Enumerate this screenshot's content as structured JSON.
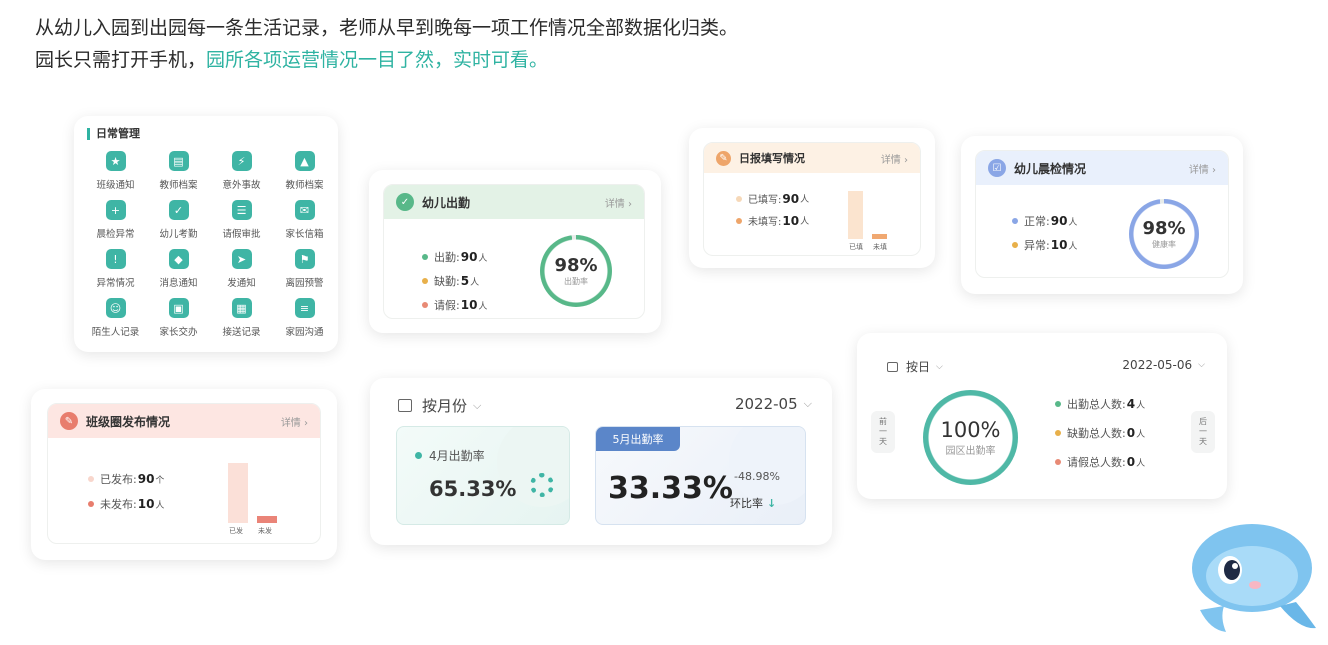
{
  "intro": {
    "line1": "从幼儿入园到出园每一条生活记录，老师从早到晚每一项工作情况全部数据化归类。",
    "line2_plain": "园长只需打开手机，",
    "line2_accent": "园所各项运营情况一目了然，实时可看。"
  },
  "daily_mgmt": {
    "title": "日常管理",
    "items": [
      {
        "label": "班级通知",
        "icon": "notice-icon",
        "color": "#3fb5a5",
        "glyph": "★"
      },
      {
        "label": "教师档案",
        "icon": "archive-icon",
        "color": "#3fb5a5",
        "glyph": "▤"
      },
      {
        "label": "意外事故",
        "icon": "accident-icon",
        "color": "#3fb5a5",
        "glyph": "⚡"
      },
      {
        "label": "教师档案",
        "icon": "bell-icon",
        "color": "#3fb5a5",
        "glyph": "▲"
      },
      {
        "label": "晨检异常",
        "icon": "medkit-icon",
        "color": "#3fb5a5",
        "glyph": "+"
      },
      {
        "label": "幼儿考勤",
        "icon": "attendance-icon",
        "color": "#3fb5a5",
        "glyph": "✓"
      },
      {
        "label": "请假审批",
        "icon": "approval-icon",
        "color": "#3fb5a5",
        "glyph": "☰"
      },
      {
        "label": "家长信箱",
        "icon": "mail-icon",
        "color": "#3fb5a5",
        "glyph": "✉"
      },
      {
        "label": "异常情况",
        "icon": "alert-icon",
        "color": "#3fb5a5",
        "glyph": "!"
      },
      {
        "label": "消息通知",
        "icon": "alarm-icon",
        "color": "#3fb5a5",
        "glyph": "◆"
      },
      {
        "label": "发通知",
        "icon": "send-icon",
        "color": "#3fb5a5",
        "glyph": "➤"
      },
      {
        "label": "离园预警",
        "icon": "warning-icon",
        "color": "#3fb5a5",
        "glyph": "⚑"
      },
      {
        "label": "陌生人记录",
        "icon": "face-scan-icon",
        "color": "#3fb5a5",
        "glyph": "☺"
      },
      {
        "label": "家长交办",
        "icon": "box-icon",
        "color": "#3fb5a5",
        "glyph": "▣"
      },
      {
        "label": "接送记录",
        "icon": "pickup-icon",
        "color": "#3fb5a5",
        "glyph": "▦"
      },
      {
        "label": "家园沟通",
        "icon": "chat-icon",
        "color": "#3fb5a5",
        "glyph": "≡"
      }
    ]
  },
  "attendance": {
    "title": "幼儿出勤",
    "detail": "详情 ›",
    "stats": [
      {
        "label": "出勤:",
        "value": "90",
        "unit": "人",
        "color": "#58b889"
      },
      {
        "label": "缺勤:",
        "value": "5",
        "unit": "人",
        "color": "#e8b04a"
      },
      {
        "label": "请假:",
        "value": "10",
        "unit": "人",
        "color": "#e88a75"
      }
    ],
    "ring_pct": "98%",
    "ring_label": "出勤率",
    "ring_value": 0.98,
    "header_color": "#e3f2e6",
    "accent": "#58b889"
  },
  "daily_report": {
    "title": "日报填写情况",
    "detail": "详情 ›",
    "stats": [
      {
        "label": "已填写:",
        "value": "90",
        "unit": "人",
        "color": "#f6d8b8"
      },
      {
        "label": "未填写:",
        "value": "10",
        "unit": "人",
        "color": "#eea56a"
      }
    ],
    "bars": [
      {
        "label": "已填",
        "value": 90,
        "color": "#fbe4cf"
      },
      {
        "label": "未填",
        "value": 10,
        "color": "#f0a871"
      }
    ],
    "header_color": "#fdf1e4",
    "accent": "#eea56a"
  },
  "morning_check": {
    "title": "幼儿晨检情况",
    "detail": "详情 ›",
    "stats": [
      {
        "label": "正常:",
        "value": "90",
        "unit": "人",
        "color": "#8aa6e6"
      },
      {
        "label": "异常:",
        "value": "10",
        "unit": "人",
        "color": "#e8b04a"
      }
    ],
    "ring_pct": "98%",
    "ring_label": "健康率",
    "ring_value": 0.98,
    "header_color": "#e9f0fc",
    "accent": "#8aa6e6"
  },
  "class_posts": {
    "title": "班级圈发布情况",
    "detail": "详情 ›",
    "stats": [
      {
        "label": "已发布:",
        "value": "90",
        "unit": "个",
        "color": "#f8d6cc"
      },
      {
        "label": "未发布:",
        "value": "10",
        "unit": "人",
        "color": "#e87d6d"
      }
    ],
    "bars": [
      {
        "label": "已发",
        "value": 90,
        "color": "#fbe0d8"
      },
      {
        "label": "未发",
        "value": 10,
        "color": "#ea8478"
      }
    ],
    "header_color": "#fde6e2",
    "accent": "#e87d6d"
  },
  "monthly": {
    "mode": "按月份",
    "date": "2022-05",
    "prev_title": "4月出勤率",
    "prev_value": "65.33%",
    "curr_badge": "5月出勤率",
    "curr_value": "33.33%",
    "change": "-48.98%",
    "change_label": "环比率",
    "accent": "#3fb5a5",
    "badge_color": "#5b86c9"
  },
  "daily_view": {
    "mode": "按日",
    "date": "2022-05-06",
    "prev": "前一天",
    "next": "后一天",
    "ring_pct": "100%",
    "ring_label": "园区出勤率",
    "ring_value": 1.0,
    "stats": [
      {
        "label": "出勤总人数:",
        "value": "4",
        "unit": "人",
        "color": "#58b889"
      },
      {
        "label": "缺勤总人数:",
        "value": "0",
        "unit": "人",
        "color": "#e8b04a"
      },
      {
        "label": "请假总人数:",
        "value": "0",
        "unit": "人",
        "color": "#e88a75"
      }
    ],
    "accent": "#4fb8a6"
  }
}
